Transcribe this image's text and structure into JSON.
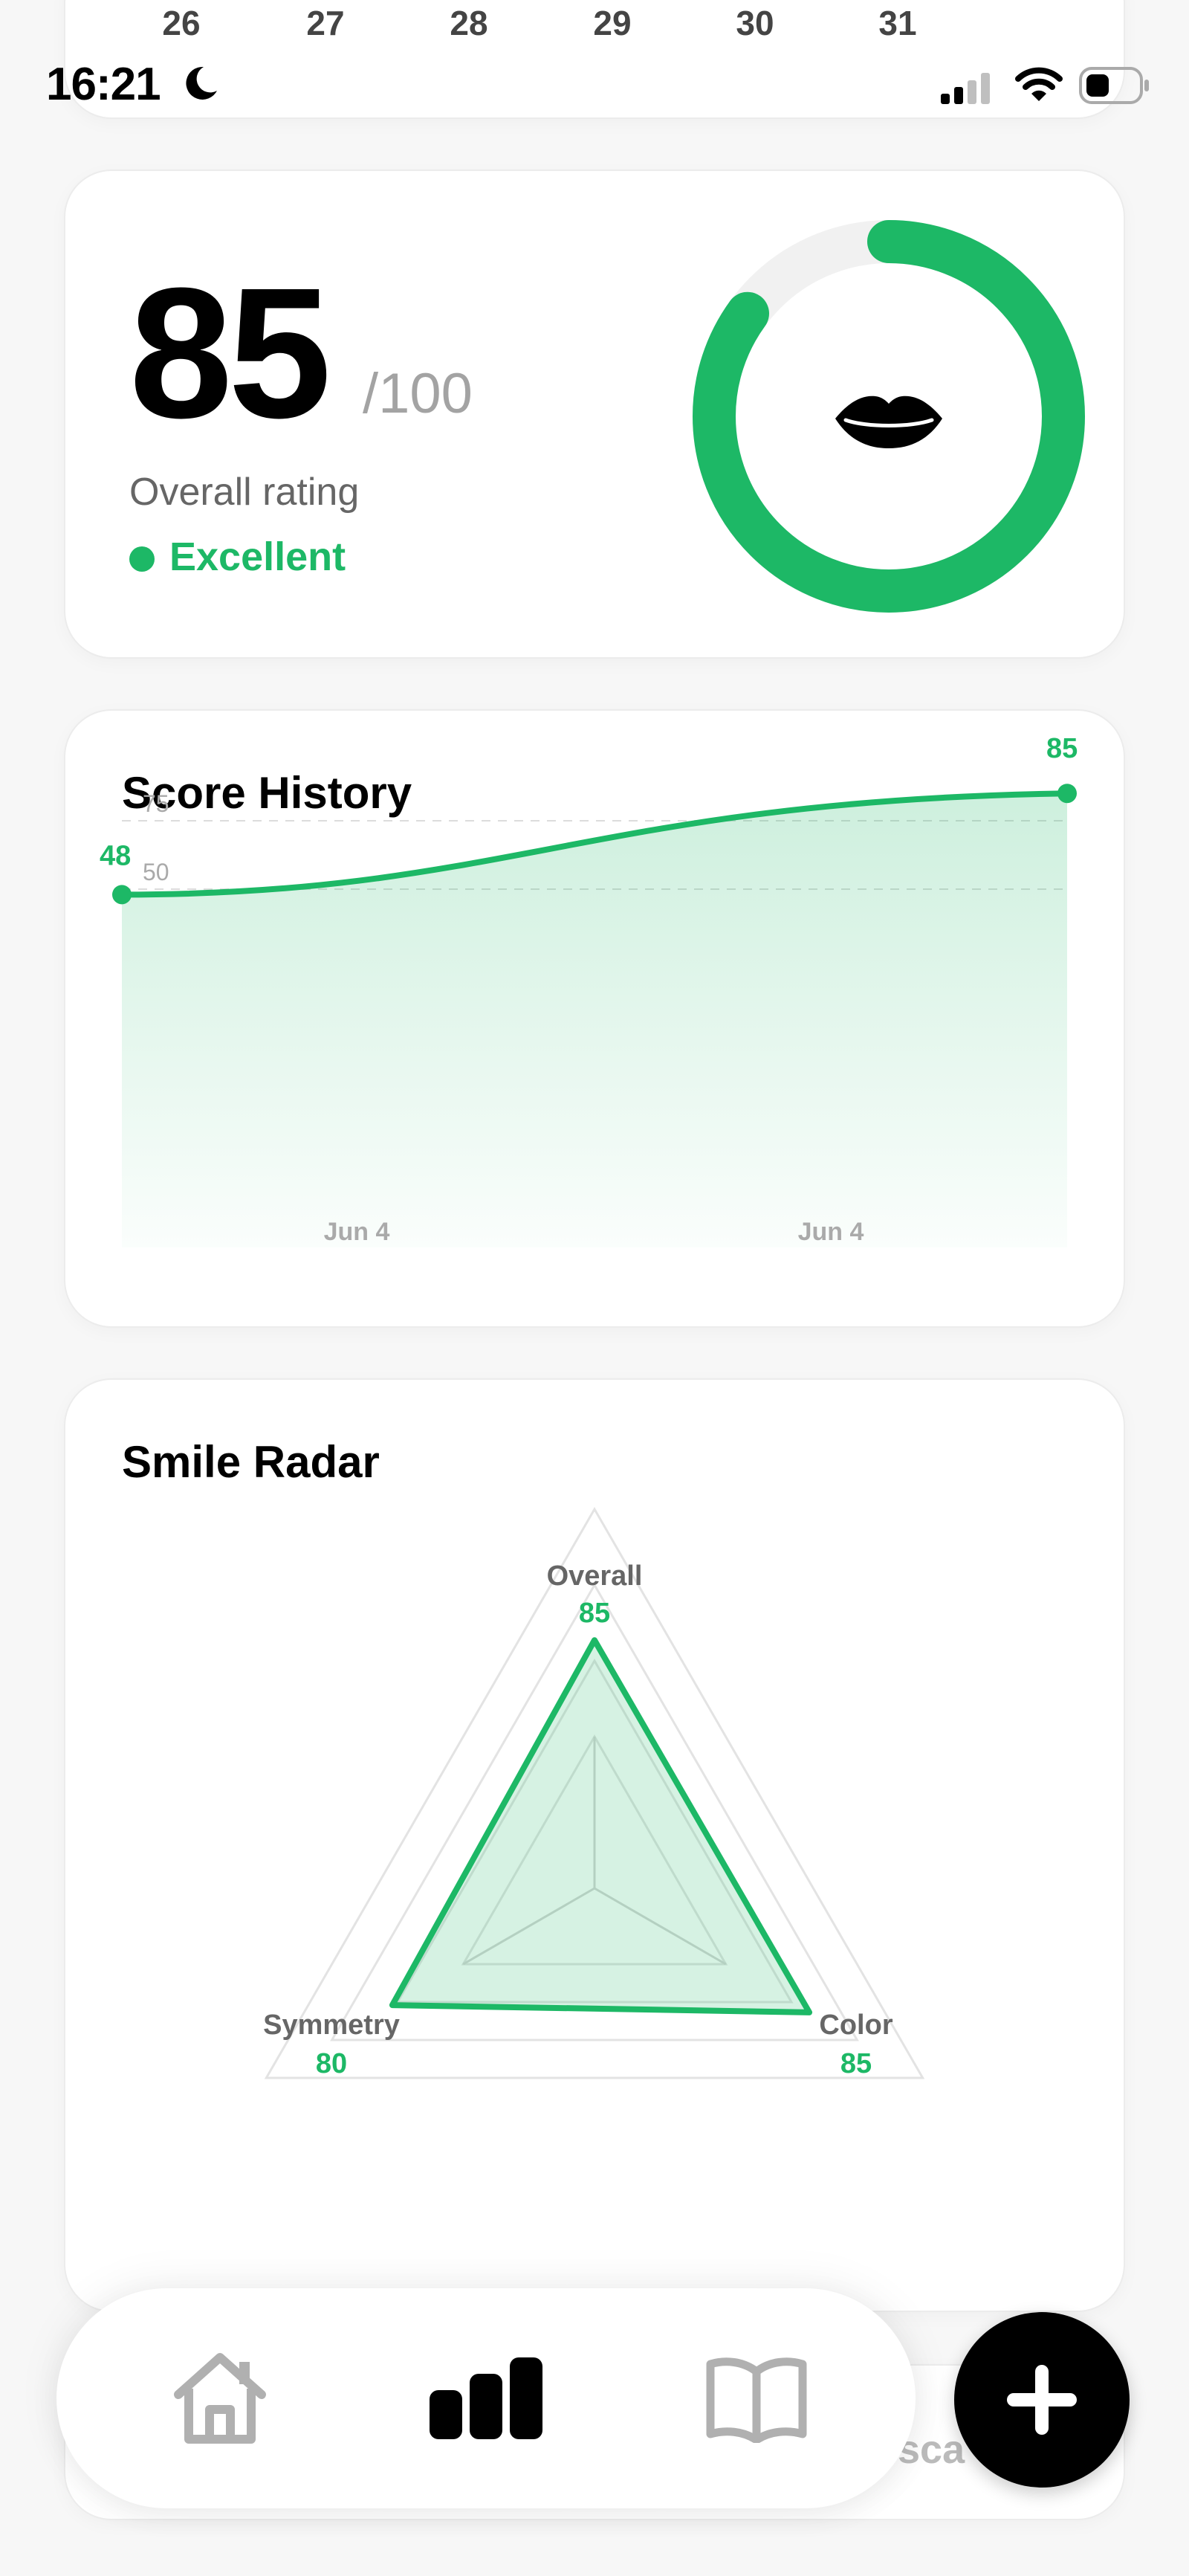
{
  "calendar": {
    "days": [
      "26",
      "27",
      "28",
      "29",
      "30",
      "31"
    ]
  },
  "status_bar": {
    "time": "16:21",
    "icons": [
      "moon-icon",
      "signal-icon",
      "wifi-icon",
      "battery-icon"
    ]
  },
  "rating": {
    "score": "85",
    "max": "/100",
    "label": "Overall rating",
    "status": "Excellent",
    "progress_percent": 85,
    "icon": "lips-icon",
    "accent_color": "#1db866"
  },
  "history": {
    "title": "Score History",
    "chart_data": {
      "type": "area",
      "x": [
        "Jun 4",
        "Jun 4"
      ],
      "points": [
        {
          "label": "48",
          "value": 48
        },
        {
          "label": "85",
          "value": 85
        }
      ],
      "gridlines": [
        75,
        50
      ],
      "gridline_labels": [
        "75",
        "50"
      ],
      "tick_labels": [
        "Jun 4",
        "Jun 4"
      ],
      "ylim": [
        40,
        90
      ]
    }
  },
  "radar": {
    "title": "Smile Radar",
    "chart_data": {
      "type": "radar",
      "axes": [
        {
          "name": "Overall",
          "value": 85,
          "label": "85"
        },
        {
          "name": "Color",
          "value": 85,
          "label": "85"
        },
        {
          "name": "Symmetry",
          "value": 80,
          "label": "80"
        }
      ],
      "max": 100
    }
  },
  "partial_card": {
    "text": "sca"
  },
  "nav": {
    "items": [
      {
        "name": "home",
        "icon": "home-icon",
        "active": false
      },
      {
        "name": "stats",
        "icon": "bar-chart-icon",
        "active": true
      },
      {
        "name": "guide",
        "icon": "book-icon",
        "active": false
      }
    ],
    "fab_icon": "plus-icon"
  },
  "colors": {
    "accent": "#1db866",
    "inactive": "#b0b0b0",
    "active": "#000000"
  }
}
